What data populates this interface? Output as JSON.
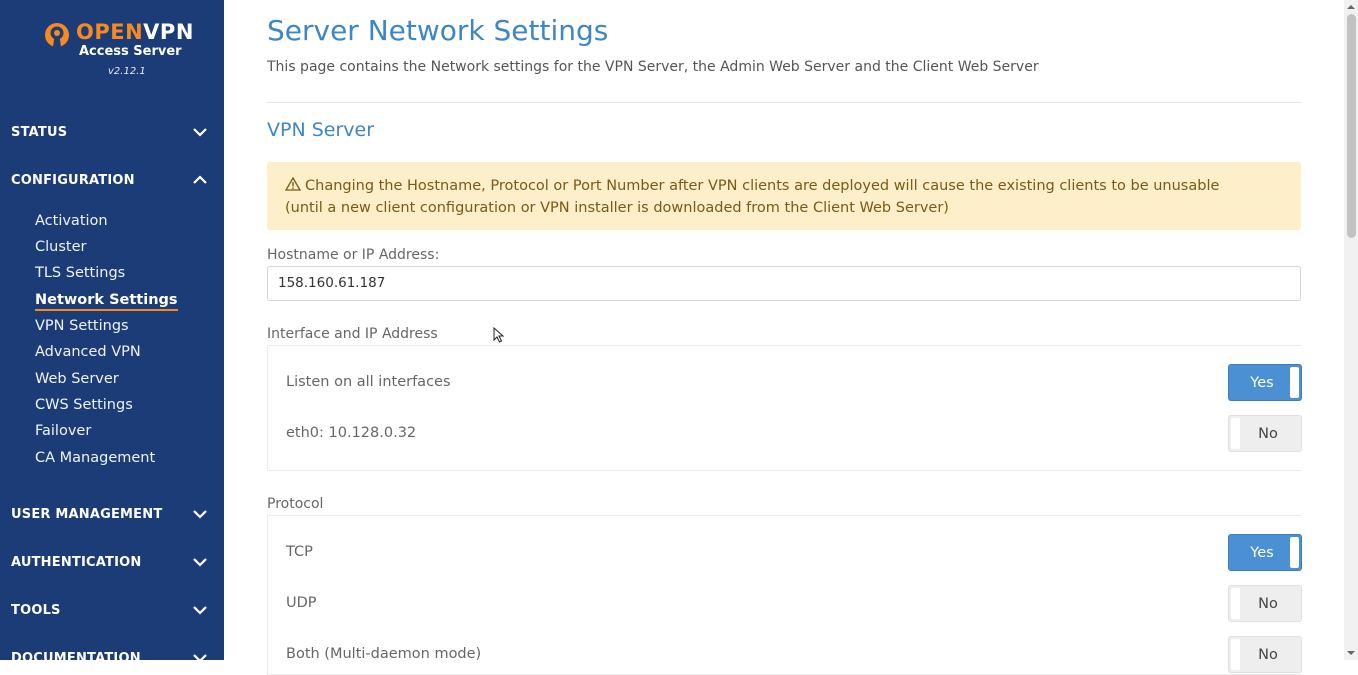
{
  "sidebar": {
    "logo": {
      "brand_open": "OPEN",
      "brand_vpn": "VPN",
      "subtitle": "Access Server",
      "version": "v2.12.1"
    },
    "sections": [
      {
        "label": "STATUS",
        "chevron": "chevron-down-icon"
      },
      {
        "label": "CONFIGURATION",
        "chevron": "chevron-up-icon"
      },
      {
        "label": "USER MANAGEMENT",
        "chevron": "chevron-down-icon"
      },
      {
        "label": "AUTHENTICATION",
        "chevron": "chevron-down-icon"
      },
      {
        "label": "TOOLS",
        "chevron": "chevron-down-icon"
      },
      {
        "label": "DOCUMENTATION",
        "chevron": "chevron-down-icon"
      }
    ],
    "config_items": [
      {
        "label": "Activation"
      },
      {
        "label": "Cluster"
      },
      {
        "label": "TLS Settings"
      },
      {
        "label": "Network Settings",
        "active": true
      },
      {
        "label": "VPN Settings"
      },
      {
        "label": "Advanced VPN"
      },
      {
        "label": "Web Server"
      },
      {
        "label": "CWS Settings"
      },
      {
        "label": "Failover"
      },
      {
        "label": "CA Management"
      }
    ]
  },
  "main": {
    "title": "Server Network Settings",
    "description": "This page contains the Network settings for the VPN Server, the Admin Web Server and the Client Web Server",
    "vpn_server": {
      "title": "VPN Server",
      "warning_line1": "Changing the Hostname, Protocol or Port Number after VPN clients are deployed will cause the existing clients to be unusable",
      "warning_line2": "(until a new client configuration or VPN installer is downloaded from the Client Web Server)",
      "hostname_label": "Hostname or IP Address:",
      "hostname_value": "158.160.61.187",
      "interface_label": "Interface and IP Address",
      "interfaces": [
        {
          "label": "Listen on all interfaces",
          "toggle": "Yes",
          "on": true
        },
        {
          "label": "eth0: 10.128.0.32",
          "toggle": "No",
          "on": false
        }
      ],
      "protocol_label": "Protocol",
      "protocols": [
        {
          "label": "TCP",
          "toggle": "Yes",
          "on": true
        },
        {
          "label": "UDP",
          "toggle": "No",
          "on": false
        },
        {
          "label": "Both (Multi-daemon mode)",
          "toggle": "No",
          "on": false
        }
      ]
    }
  },
  "colors": {
    "sidebar_bg": "#1b3c76",
    "accent_orange": "#f68a1e",
    "title_blue": "#3e86c4",
    "toggle_on": "#4a90d2",
    "warning_bg": "#fcefc9"
  }
}
